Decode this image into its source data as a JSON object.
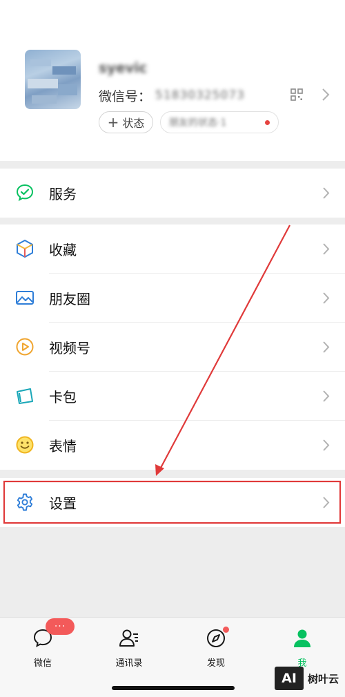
{
  "profile": {
    "nickname": "syevic",
    "wechat_id_label": "微信号：",
    "wechat_id_value": "51830325073",
    "status_button_plus": "+",
    "status_button_label": "状态",
    "friends_status_text": "朋友的状态·1"
  },
  "menu": {
    "service": {
      "label": "服务",
      "icon": "service-icon"
    },
    "favorites": {
      "label": "收藏",
      "icon": "favorites-icon"
    },
    "moments": {
      "label": "朋友圈",
      "icon": "moments-icon"
    },
    "channels": {
      "label": "视频号",
      "icon": "channels-icon"
    },
    "cards": {
      "label": "卡包",
      "icon": "card-wallet-icon"
    },
    "stickers": {
      "label": "表情",
      "icon": "sticker-icon"
    },
    "settings": {
      "label": "设置",
      "icon": "gear-icon"
    }
  },
  "tabbar": {
    "chats": {
      "label": "微信",
      "badge": "···"
    },
    "contacts": {
      "label": "通讯录"
    },
    "discover": {
      "label": "发现"
    },
    "me": {
      "label": "我"
    }
  },
  "watermark": {
    "logo": "AI",
    "text": "树叶云"
  },
  "colors": {
    "wechat_green": "#07c160",
    "annotation_red": "#e03a3a",
    "badge_red": "#f35a5a",
    "background": "#ededed"
  }
}
